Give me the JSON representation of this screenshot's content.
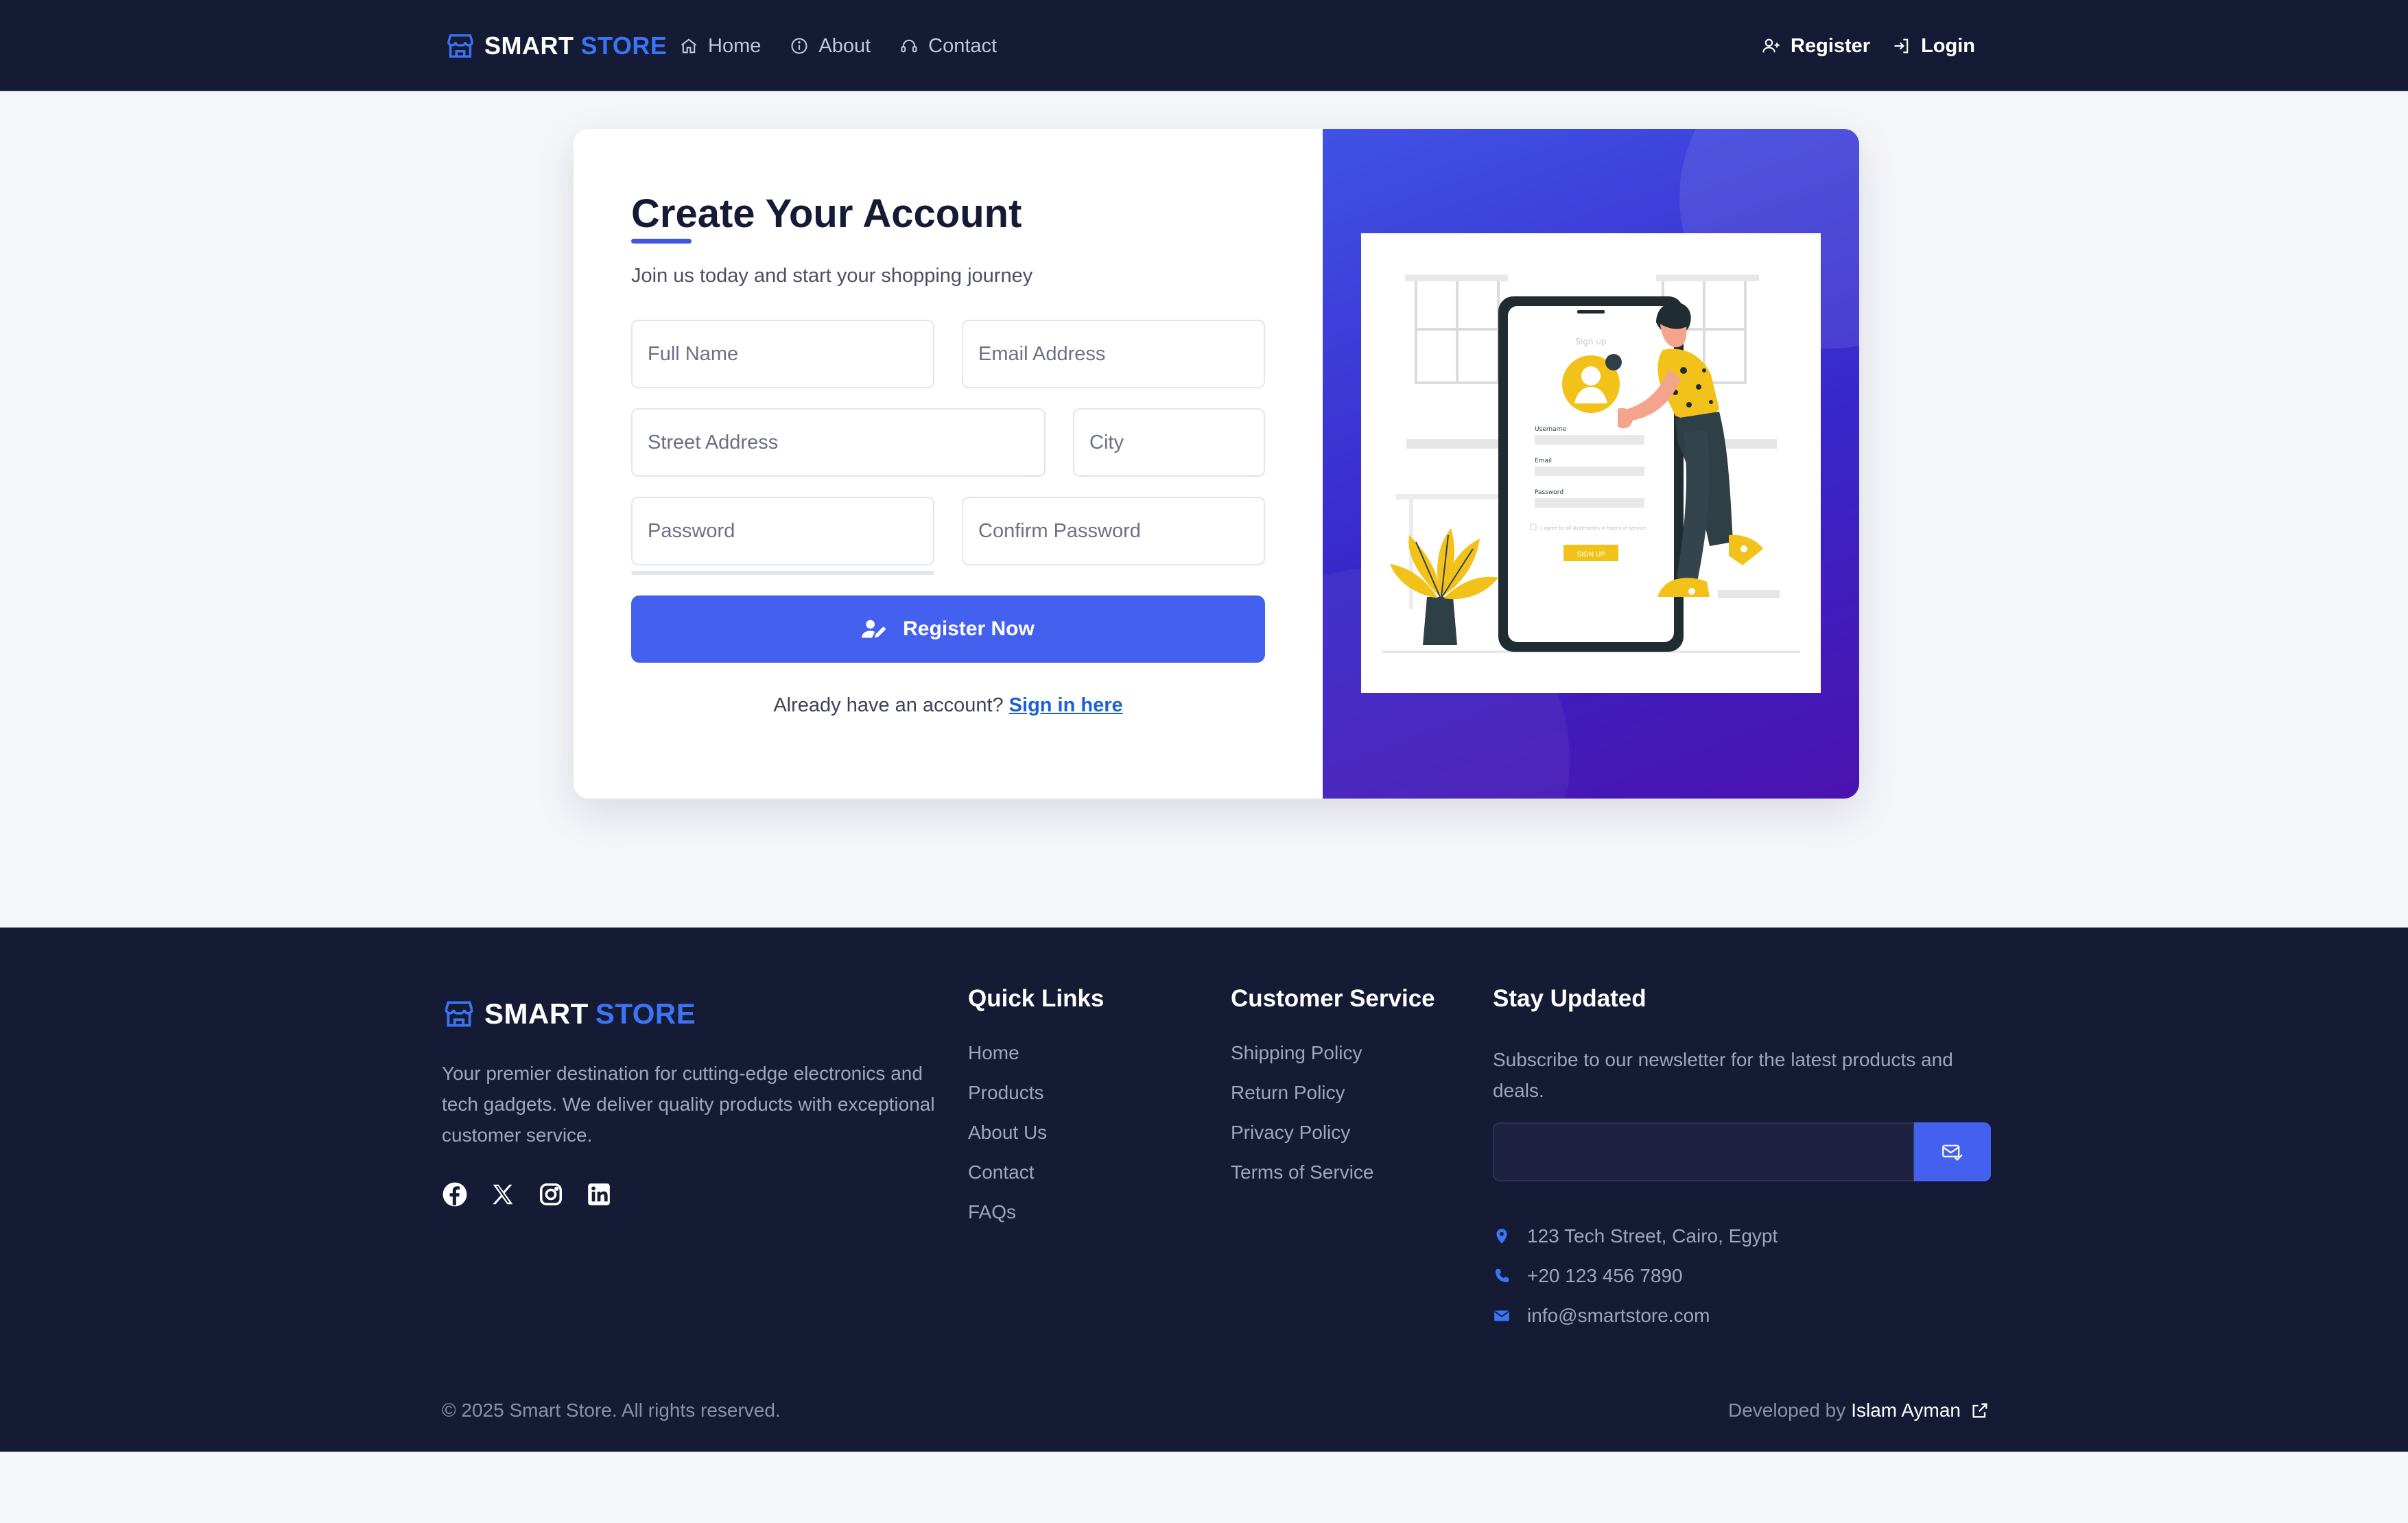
{
  "navbar": {
    "brand_main": "SMART",
    "brand_accent": "STORE",
    "links": [
      {
        "label": "Home",
        "icon": "home-icon"
      },
      {
        "label": "About",
        "icon": "info-icon"
      },
      {
        "label": "Contact",
        "icon": "headset-icon"
      }
    ],
    "register_label": "Register",
    "login_label": "Login"
  },
  "form": {
    "title": "Create Your Account",
    "subtitle": "Join us today and start your shopping journey",
    "fields": {
      "full_name": "Full Name",
      "email": "Email Address",
      "street": "Street Address",
      "city": "City",
      "password": "Password",
      "confirm_password": "Confirm Password"
    },
    "submit_label": "Register Now",
    "signin_prompt": "Already have an account?",
    "signin_link": "Sign in here"
  },
  "illustration": {
    "phone_title": "Sign up",
    "labels": [
      "Username",
      "Email",
      "Password"
    ],
    "terms": "I agree to all statements in terms of service",
    "button": "SIGN UP"
  },
  "footer": {
    "brand_main": "SMART",
    "brand_accent": "STORE",
    "description": "Your premier destination for cutting-edge electronics and tech gadgets. We deliver quality products with exceptional customer service.",
    "socials": [
      "facebook-icon",
      "x-icon",
      "instagram-icon",
      "linkedin-icon"
    ],
    "quick_links": {
      "heading": "Quick Links",
      "items": [
        "Home",
        "Products",
        "About Us",
        "Contact",
        "FAQs"
      ]
    },
    "customer_service": {
      "heading": "Customer Service",
      "items": [
        "Shipping Policy",
        "Return Policy",
        "Privacy Policy",
        "Terms of Service"
      ]
    },
    "newsletter": {
      "heading": "Stay Updated",
      "text": "Subscribe to our newsletter for the latest products and deals.",
      "input_value": ""
    },
    "contact": {
      "address": "123 Tech Street, Cairo, Egypt",
      "phone": "+20 123 456 7890",
      "email": "info@smartstore.com"
    },
    "copyright": "© 2025 Smart Store. All rights reserved.",
    "developed_by": "Developed by",
    "developer": "Islam Ayman"
  },
  "colors": {
    "nav_bg": "#161b35",
    "accent": "#4361ee",
    "brand_accent": "#3b74f5",
    "illus_gradient_start": "#4052e6",
    "illus_gradient_end": "#4b12b0"
  }
}
